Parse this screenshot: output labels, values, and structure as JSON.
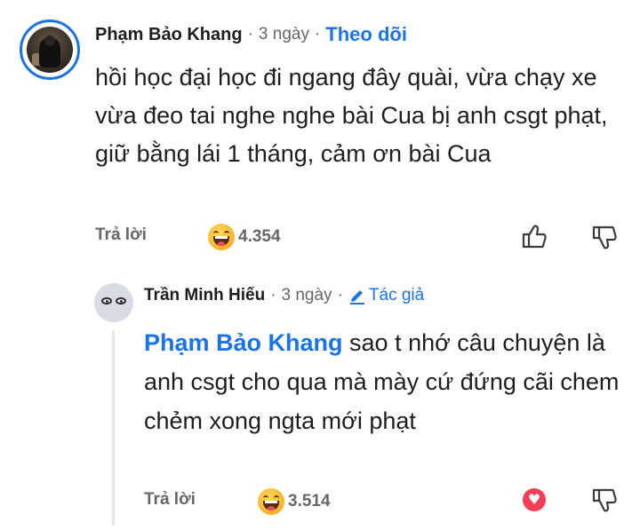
{
  "comment": {
    "author": "Phạm Bảo Khang",
    "separator": "·",
    "age": "3 ngày",
    "follow_label": "Theo dõi",
    "text": "hồi học đại học đi ngang đây quài, vừa chạy xe vừa đeo tai nghe nghe bài Cua bị anh csgt phạt, giữ bằng lái 1 tháng, cảm ơn bài Cua",
    "reply_label": "Trả lời",
    "reaction_icon": "laughing-emoji",
    "reaction_count": "4.354"
  },
  "reply": {
    "author": "Trần Minh Hiếu",
    "separator": "·",
    "age": "3 ngày",
    "badge_label": "Tác giả",
    "mention": "Phạm Bảo Khang",
    "text": " sao t nhớ câu chuyện là anh csgt cho qua mà mày cứ đứng cãi chem chẻm xong ngta mới phạt",
    "reply_label": "Trả lời",
    "reaction_icon": "laughing-emoji",
    "reaction_count": "3.514",
    "liked_icon": "heart-icon"
  },
  "colors": {
    "accent": "#1a73e8",
    "muted": "#65676b",
    "heart": "#f33e58"
  }
}
